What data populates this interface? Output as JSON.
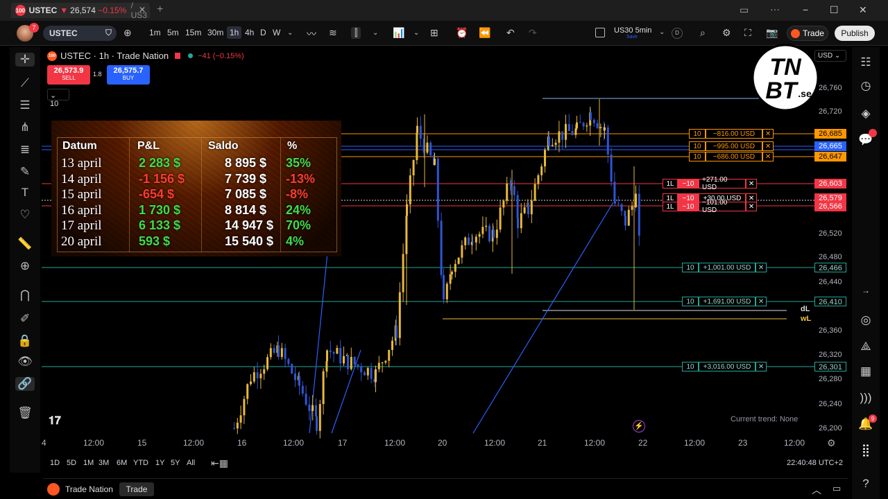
{
  "browser": {
    "tab": {
      "badge": "100",
      "symbol": "USTEC",
      "arrow": "▼",
      "price": "26,574",
      "change": "−0.15%",
      "rest": "/ US3"
    },
    "controls": {
      "minimize": "−",
      "maximize": "☐",
      "close": "✕"
    }
  },
  "toolbar": {
    "avatar_badge": "7",
    "symbol": "USTEC",
    "intervals": [
      "1m",
      "5m",
      "15m",
      "30m",
      "1h",
      "4h",
      "D",
      "W"
    ],
    "active_interval": "1h",
    "layout_name": "US30 5min",
    "layout_sub": "Save",
    "layout_d": "D",
    "trade": "Trade",
    "publish": "Publish"
  },
  "legend": {
    "symbol": "USTEC · 1h · Trade Nation",
    "change": "−41 (−0.15%)",
    "sell_price": "26,573.9",
    "sell_label": "SELL",
    "spread": "1.8",
    "buy_price": "26,575.7",
    "buy_label": "BUY",
    "qty": "10"
  },
  "pnl_table": {
    "headers": {
      "date": "Datum",
      "pl": "P&L",
      "saldo": "Saldo",
      "pct": "%"
    },
    "rows": [
      {
        "date": "13 april",
        "pl": "2 283 $",
        "saldo": "8 895 $",
        "pct": "35%",
        "sign": "pos"
      },
      {
        "date": "14 april",
        "pl": "-1 156 $",
        "saldo": "7 739 $",
        "pct": "-13%",
        "sign": "neg"
      },
      {
        "date": "15 april",
        "pl": "-654 $",
        "saldo": "7 085 $",
        "pct": "-8%",
        "sign": "neg"
      },
      {
        "date": "16 april",
        "pl": "1 730 $",
        "saldo": "8 814 $",
        "pct": "24%",
        "sign": "pos"
      },
      {
        "date": "17 april",
        "pl": "6 133 $",
        "saldo": "14 947 $",
        "pct": "70%",
        "sign": "pos"
      },
      {
        "date": "20 april",
        "pl": "593 $",
        "saldo": "15 540 $",
        "pct": "4%",
        "sign": "pos"
      }
    ]
  },
  "price_axis": {
    "currency": "USD",
    "ticks": [
      "26,760",
      "26,720",
      "26,520",
      "26,480",
      "26,440",
      "26,360",
      "26,320",
      "26,280",
      "26,240",
      "26,200"
    ],
    "tags": [
      {
        "label": "26,685",
        "color": "#ff9800"
      },
      {
        "label": "26,665",
        "color": "#2962ff"
      },
      {
        "label": "26,647",
        "color": "#ff9800"
      },
      {
        "label": "26,603",
        "color": "#f23645"
      },
      {
        "label": "26,579",
        "color": "#f23645"
      },
      {
        "label": "26,566",
        "color": "#f23645"
      },
      {
        "label": "26,466",
        "color": "#26a69a"
      },
      {
        "label": "26,410",
        "color": "#26a69a"
      },
      {
        "label": "26,301",
        "color": "#26a69a"
      }
    ]
  },
  "orders": [
    {
      "qty": "10",
      "pnl": "−816.00 USD",
      "kind": "or"
    },
    {
      "qty": "10",
      "pnl": "−995.00 USD",
      "kind": "or"
    },
    {
      "qty": "10",
      "pnl": "−686.00 USD",
      "kind": "or"
    },
    {
      "qty": "−10",
      "pnl": "+271.00 USD",
      "kind": "rd"
    },
    {
      "qty": "−10",
      "pnl": "+30.00 USD",
      "kind": "rd"
    },
    {
      "qty": "−10",
      "pnl": "−101.00 USD",
      "kind": "rd"
    },
    {
      "qty": "10",
      "pnl": "+1,001.00 USD",
      "kind": "gr"
    },
    {
      "qty": "10",
      "pnl": "+1,691.00 USD",
      "kind": "gr"
    },
    {
      "qty": "10",
      "pnl": "+3,016.00 USD",
      "kind": "gr"
    }
  ],
  "order_tag": "1L",
  "order_close": "✕",
  "labels": {
    "dl": "dL",
    "wl": "wL",
    "trend": "Current trend: None"
  },
  "time_axis": [
    "4",
    "12:00",
    "15",
    "12:00",
    "16",
    "12:00",
    "17",
    "12:00",
    "20",
    "12:00",
    "21",
    "12:00",
    "22",
    "12:00",
    "23",
    "12:00"
  ],
  "ranges": [
    "1D",
    "5D",
    "1M",
    "3M",
    "6M",
    "YTD",
    "1Y",
    "5Y",
    "All"
  ],
  "clock": "22:40:48 UTC+2",
  "footer": {
    "broker": "Trade Nation",
    "trade": "Trade"
  },
  "watermark": {
    "line1": "TN",
    "line2": "BT",
    "suffix": ".se"
  },
  "sidebar_badges": {
    "chat": "",
    "alerts": "9"
  },
  "colors": {
    "up": "#e8b93a",
    "down": "#2f55d4",
    "positive": "#3ddc4a",
    "negative": "#ff3b30"
  }
}
